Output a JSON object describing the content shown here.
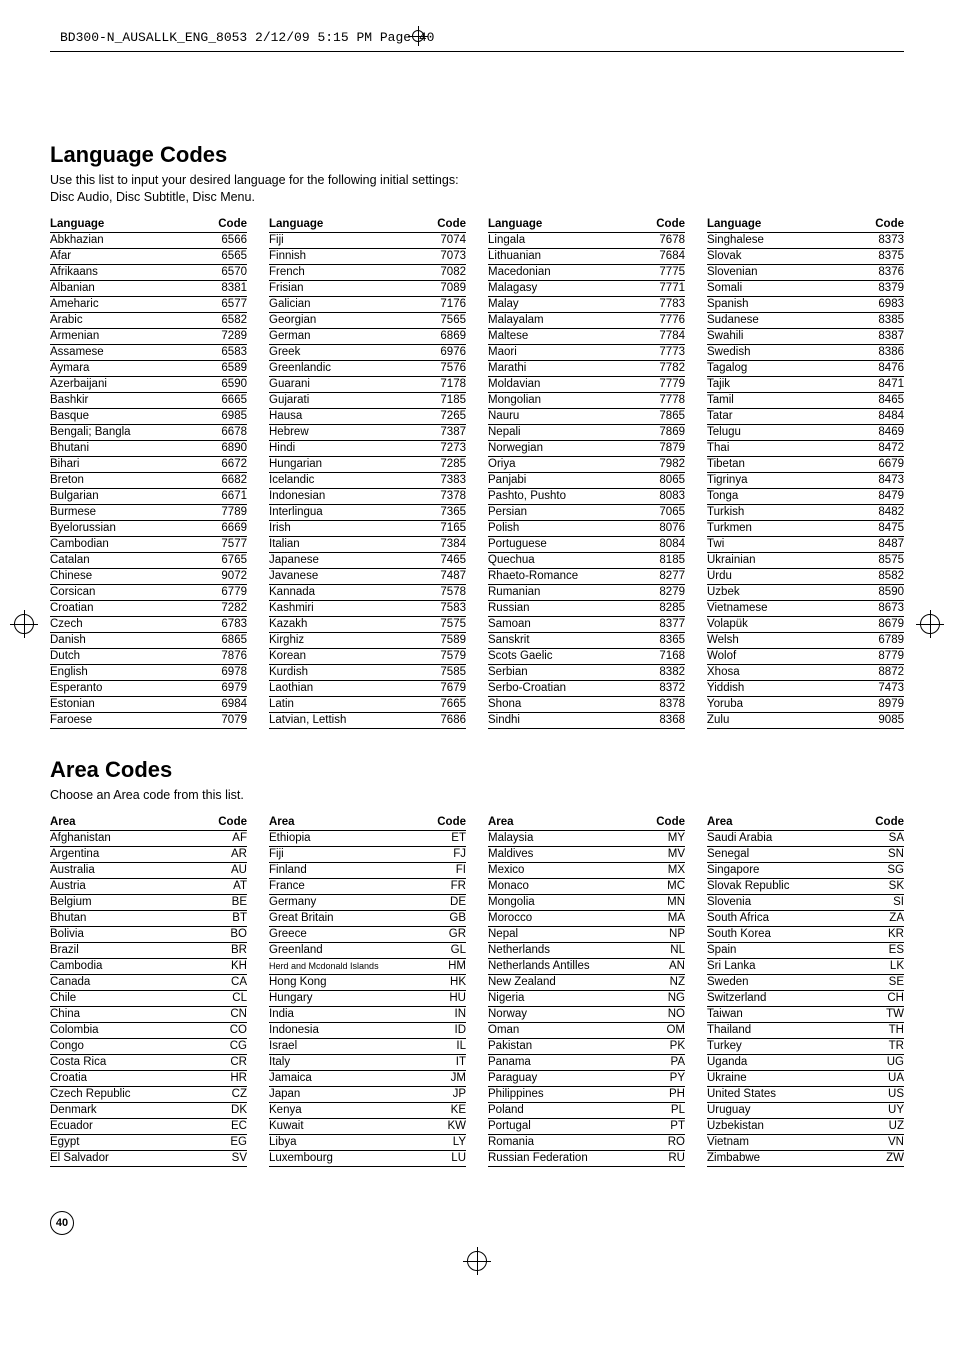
{
  "header_line": "BD300-N_AUSALLK_ENG_8053  2/12/09  5:15 PM  Page 40",
  "page_number": "40",
  "language_section": {
    "title": "Language Codes",
    "description": "Use this list to input your desired language for the following initial settings:\nDisc Audio, Disc Subtitle, Disc Menu.",
    "col_headers": [
      "Language",
      "Code"
    ],
    "columns": [
      [
        [
          "Abkhazian",
          "6566"
        ],
        [
          "Afar",
          "6565"
        ],
        [
          "Afrikaans",
          "6570"
        ],
        [
          "Albanian",
          "8381"
        ],
        [
          "Ameharic",
          "6577"
        ],
        [
          "Arabic",
          "6582"
        ],
        [
          "Armenian",
          "7289"
        ],
        [
          "Assamese",
          "6583"
        ],
        [
          "Aymara",
          "6589"
        ],
        [
          "Azerbaijani",
          "6590"
        ],
        [
          "Bashkir",
          "6665"
        ],
        [
          "Basque",
          "6985"
        ],
        [
          "Bengali; Bangla",
          "6678"
        ],
        [
          "Bhutani",
          "6890"
        ],
        [
          "Bihari",
          "6672"
        ],
        [
          "Breton",
          "6682"
        ],
        [
          "Bulgarian",
          "6671"
        ],
        [
          "Burmese",
          "7789"
        ],
        [
          "Byelorussian",
          "6669"
        ],
        [
          "Cambodian",
          "7577"
        ],
        [
          "Catalan",
          "6765"
        ],
        [
          "Chinese",
          "9072"
        ],
        [
          "Corsican",
          "6779"
        ],
        [
          "Croatian",
          "7282"
        ],
        [
          "Czech",
          "6783"
        ],
        [
          "Danish",
          "6865"
        ],
        [
          "Dutch",
          "7876"
        ],
        [
          "English",
          "6978"
        ],
        [
          "Esperanto",
          "6979"
        ],
        [
          "Estonian",
          "6984"
        ],
        [
          "Faroese",
          "7079"
        ]
      ],
      [
        [
          "Fiji",
          "7074"
        ],
        [
          "Finnish",
          "7073"
        ],
        [
          "French",
          "7082"
        ],
        [
          "Frisian",
          "7089"
        ],
        [
          "Galician",
          "7176"
        ],
        [
          "Georgian",
          "7565"
        ],
        [
          "German",
          "6869"
        ],
        [
          "Greek",
          "6976"
        ],
        [
          "Greenlandic",
          "7576"
        ],
        [
          "Guarani",
          "7178"
        ],
        [
          "Gujarati",
          "7185"
        ],
        [
          "Hausa",
          "7265"
        ],
        [
          "Hebrew",
          "7387"
        ],
        [
          "Hindi",
          "7273"
        ],
        [
          "Hungarian",
          "7285"
        ],
        [
          "Icelandic",
          "7383"
        ],
        [
          "Indonesian",
          "7378"
        ],
        [
          "Interlingua",
          "7365"
        ],
        [
          "Irish",
          "7165"
        ],
        [
          "Italian",
          "7384"
        ],
        [
          "Japanese",
          "7465"
        ],
        [
          "Javanese",
          "7487"
        ],
        [
          "Kannada",
          "7578"
        ],
        [
          "Kashmiri",
          "7583"
        ],
        [
          "Kazakh",
          "7575"
        ],
        [
          "Kirghiz",
          "7589"
        ],
        [
          "Korean",
          "7579"
        ],
        [
          "Kurdish",
          "7585"
        ],
        [
          "Laothian",
          "7679"
        ],
        [
          "Latin",
          "7665"
        ],
        [
          "Latvian, Lettish",
          "7686"
        ]
      ],
      [
        [
          "Lingala",
          "7678"
        ],
        [
          "Lithuanian",
          "7684"
        ],
        [
          "Macedonian",
          "7775"
        ],
        [
          "Malagasy",
          "7771"
        ],
        [
          "Malay",
          "7783"
        ],
        [
          "Malayalam",
          "7776"
        ],
        [
          "Maltese",
          "7784"
        ],
        [
          "Maori",
          "7773"
        ],
        [
          "Marathi",
          "7782"
        ],
        [
          "Moldavian",
          "7779"
        ],
        [
          "Mongolian",
          "7778"
        ],
        [
          "Nauru",
          "7865"
        ],
        [
          "Nepali",
          "7869"
        ],
        [
          "Norwegian",
          "7879"
        ],
        [
          "Oriya",
          "7982"
        ],
        [
          "Panjabi",
          "8065"
        ],
        [
          "Pashto, Pushto",
          "8083"
        ],
        [
          "Persian",
          "7065"
        ],
        [
          "Polish",
          "8076"
        ],
        [
          "Portuguese",
          "8084"
        ],
        [
          "Quechua",
          "8185"
        ],
        [
          "Rhaeto-Romance",
          "8277"
        ],
        [
          "Rumanian",
          "8279"
        ],
        [
          "Russian",
          "8285"
        ],
        [
          "Samoan",
          "8377"
        ],
        [
          "Sanskrit",
          "8365"
        ],
        [
          "Scots Gaelic",
          "7168"
        ],
        [
          "Serbian",
          "8382"
        ],
        [
          "Serbo-Croatian",
          "8372"
        ],
        [
          "Shona",
          "8378"
        ],
        [
          "Sindhi",
          "8368"
        ]
      ],
      [
        [
          "Singhalese",
          "8373"
        ],
        [
          "Slovak",
          "8375"
        ],
        [
          "Slovenian",
          "8376"
        ],
        [
          "Somali",
          "8379"
        ],
        [
          "Spanish",
          "6983"
        ],
        [
          "Sudanese",
          "8385"
        ],
        [
          "Swahili",
          "8387"
        ],
        [
          "Swedish",
          "8386"
        ],
        [
          "Tagalog",
          "8476"
        ],
        [
          "Tajik",
          "8471"
        ],
        [
          "Tamil",
          "8465"
        ],
        [
          "Tatar",
          "8484"
        ],
        [
          "Telugu",
          "8469"
        ],
        [
          "Thai",
          "8472"
        ],
        [
          "Tibetan",
          "6679"
        ],
        [
          "Tigrinya",
          "8473"
        ],
        [
          "Tonga",
          "8479"
        ],
        [
          "Turkish",
          "8482"
        ],
        [
          "Turkmen",
          "8475"
        ],
        [
          "Twi",
          "8487"
        ],
        [
          "Ukrainian",
          "8575"
        ],
        [
          "Urdu",
          "8582"
        ],
        [
          "Uzbek",
          "8590"
        ],
        [
          "Vietnamese",
          "8673"
        ],
        [
          "Volapük",
          "8679"
        ],
        [
          "Welsh",
          "6789"
        ],
        [
          "Wolof",
          "8779"
        ],
        [
          "Xhosa",
          "8872"
        ],
        [
          "Yiddish",
          "7473"
        ],
        [
          "Yoruba",
          "8979"
        ],
        [
          "Zulu",
          "9085"
        ]
      ]
    ]
  },
  "area_section": {
    "title": "Area Codes",
    "description": "Choose an Area code from this list.",
    "col_headers": [
      "Area",
      "Code"
    ],
    "columns": [
      [
        [
          "Afghanistan",
          "AF"
        ],
        [
          "Argentina",
          "AR"
        ],
        [
          "Australia",
          "AU"
        ],
        [
          "Austria",
          "AT"
        ],
        [
          "Belgium",
          "BE"
        ],
        [
          "Bhutan",
          "BT"
        ],
        [
          "Bolivia",
          "BO"
        ],
        [
          "Brazil",
          "BR"
        ],
        [
          "Cambodia",
          "KH"
        ],
        [
          "Canada",
          "CA"
        ],
        [
          "Chile",
          "CL"
        ],
        [
          "China",
          "CN"
        ],
        [
          "Colombia",
          "CO"
        ],
        [
          "Congo",
          "CG"
        ],
        [
          "Costa Rica",
          "CR"
        ],
        [
          "Croatia",
          "HR"
        ],
        [
          "Czech Republic",
          "CZ"
        ],
        [
          "Denmark",
          "DK"
        ],
        [
          "Ecuador",
          "EC"
        ],
        [
          "Egypt",
          "EG"
        ],
        [
          "El Salvador",
          "SV"
        ]
      ],
      [
        [
          "Ethiopia",
          "ET"
        ],
        [
          "Fiji",
          "FJ"
        ],
        [
          "Finland",
          "FI"
        ],
        [
          "France",
          "FR"
        ],
        [
          "Germany",
          "DE"
        ],
        [
          "Great Britain",
          "GB"
        ],
        [
          "Greece",
          "GR"
        ],
        [
          "Greenland",
          "GL"
        ],
        [
          "Herd and Mcdonald Islands",
          "HM"
        ],
        [
          "Hong Kong",
          "HK"
        ],
        [
          "Hungary",
          "HU"
        ],
        [
          "India",
          "IN"
        ],
        [
          "Indonesia",
          "ID"
        ],
        [
          "Israel",
          "IL"
        ],
        [
          "Italy",
          "IT"
        ],
        [
          "Jamaica",
          "JM"
        ],
        [
          "Japan",
          "JP"
        ],
        [
          "Kenya",
          "KE"
        ],
        [
          "Kuwait",
          "KW"
        ],
        [
          "Libya",
          "LY"
        ],
        [
          "Luxembourg",
          "LU"
        ]
      ],
      [
        [
          "Malaysia",
          "MY"
        ],
        [
          "Maldives",
          "MV"
        ],
        [
          "Mexico",
          "MX"
        ],
        [
          "Monaco",
          "MC"
        ],
        [
          "Mongolia",
          "MN"
        ],
        [
          "Morocco",
          "MA"
        ],
        [
          "Nepal",
          "NP"
        ],
        [
          "Netherlands",
          "NL"
        ],
        [
          "Netherlands Antilles",
          "AN"
        ],
        [
          "New Zealand",
          "NZ"
        ],
        [
          "Nigeria",
          "NG"
        ],
        [
          "Norway",
          "NO"
        ],
        [
          "Oman",
          "OM"
        ],
        [
          "Pakistan",
          "PK"
        ],
        [
          "Panama",
          "PA"
        ],
        [
          "Paraguay",
          "PY"
        ],
        [
          "Philippines",
          "PH"
        ],
        [
          "Poland",
          "PL"
        ],
        [
          "Portugal",
          "PT"
        ],
        [
          "Romania",
          "RO"
        ],
        [
          "Russian Federation",
          "RU"
        ]
      ],
      [
        [
          "Saudi Arabia",
          "SA"
        ],
        [
          "Senegal",
          "SN"
        ],
        [
          "Singapore",
          "SG"
        ],
        [
          "Slovak Republic",
          "SK"
        ],
        [
          "Slovenia",
          "SI"
        ],
        [
          "South Africa",
          "ZA"
        ],
        [
          "South Korea",
          "KR"
        ],
        [
          "Spain",
          "ES"
        ],
        [
          "Sri Lanka",
          "LK"
        ],
        [
          "Sweden",
          "SE"
        ],
        [
          "Switzerland",
          "CH"
        ],
        [
          "Taiwan",
          "TW"
        ],
        [
          "Thailand",
          "TH"
        ],
        [
          "Turkey",
          "TR"
        ],
        [
          "Uganda",
          "UG"
        ],
        [
          "Ukraine",
          "UA"
        ],
        [
          "United States",
          "US"
        ],
        [
          "Uruguay",
          "UY"
        ],
        [
          "Uzbekistan",
          "UZ"
        ],
        [
          "Vietnam",
          "VN"
        ],
        [
          "Zimbabwe",
          "ZW"
        ]
      ]
    ]
  }
}
